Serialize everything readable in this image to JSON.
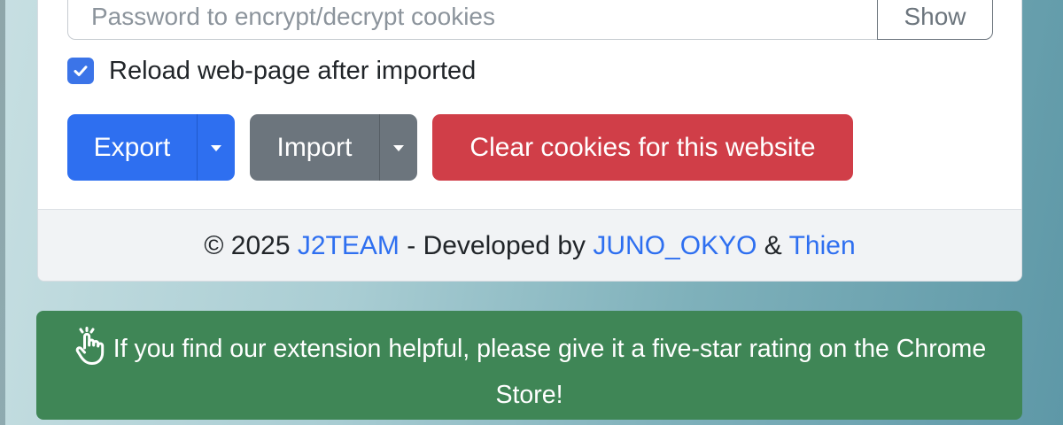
{
  "password": {
    "placeholder": "Password to encrypt/decrypt cookies",
    "value": "",
    "show_label": "Show"
  },
  "reload": {
    "label": "Reload web-page after imported",
    "checked": true
  },
  "buttons": {
    "export_label": "Export",
    "import_label": "Import",
    "clear_label": "Clear cookies for this website"
  },
  "footer": {
    "copyright": "© 2025",
    "team_link": "J2TEAM",
    "developed_by": "- Developed by",
    "dev1_link": "JUNO_OKYO",
    "amp": "&",
    "dev2_link": "Thien"
  },
  "banner": {
    "icon": "hand-pointer-icon",
    "text": "If you find our extension helpful, please give it a five-star rating on the Chrome Store!"
  },
  "colors": {
    "primary": "#2e6ff0",
    "secondary": "#6c757d",
    "danger": "#d03e48",
    "success": "#3f8656"
  }
}
